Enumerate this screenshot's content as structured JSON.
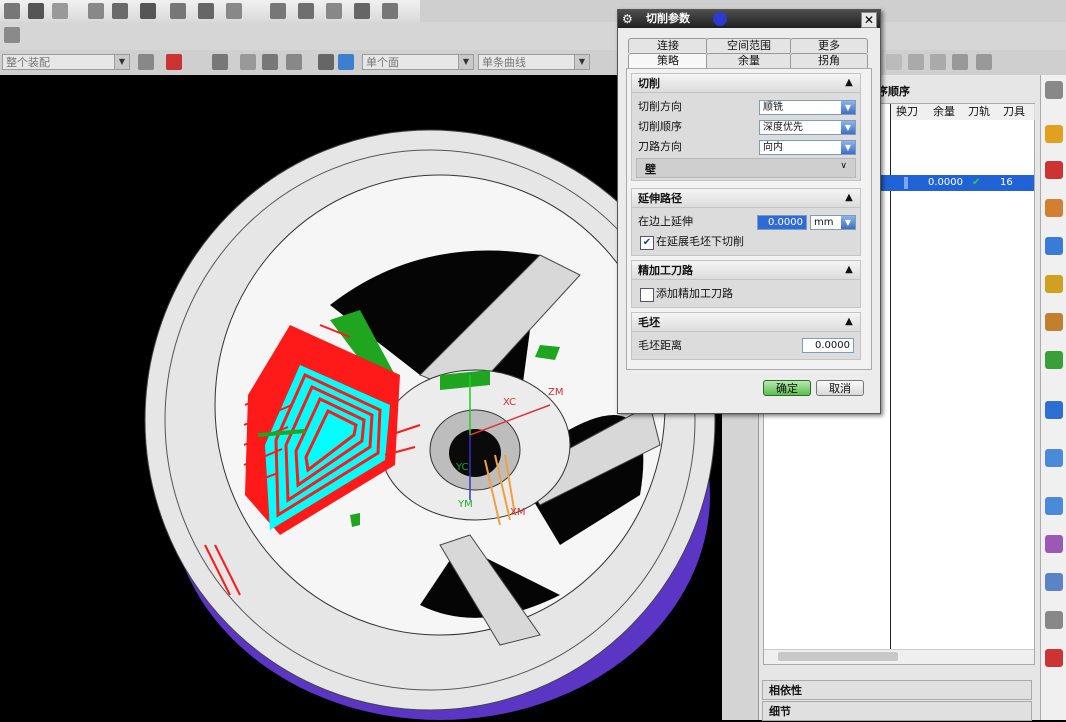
{
  "toolbar": {
    "combo_filter": "整个装配",
    "combo_single_face": "单个面",
    "combo_single_curve": "单条曲线"
  },
  "navigator": {
    "header": "序顺序",
    "columns": [
      "换刀",
      "余量",
      "刀轨",
      "刀具"
    ],
    "selected_row": {
      "allowance": "0.0000",
      "path_check": "✔",
      "tool": "16"
    },
    "sections": [
      "相依性",
      "细节"
    ]
  },
  "dialog": {
    "title": "切削参数",
    "tabs_top": [
      "连接",
      "空间范围",
      "更多"
    ],
    "tabs_bottom": [
      "策略",
      "余量",
      "拐角"
    ],
    "cutting": {
      "header": "切削",
      "direction_label": "切削方向",
      "direction_value": "顺铣",
      "order_label": "切削顺序",
      "order_value": "深度优先",
      "path_dir_label": "刀路方向",
      "path_dir_value": "向内",
      "wall_label": "壁"
    },
    "extend": {
      "header": "延伸路径",
      "edge_extend_label": "在边上延伸",
      "edge_extend_value": "0.0000",
      "unit": "mm",
      "cut_below_label": "在延展毛坯下切削"
    },
    "finish": {
      "header": "精加工刀路",
      "add_label": "添加精加工刀路"
    },
    "blank": {
      "header": "毛坯",
      "distance_label": "毛坯距离",
      "distance_value": "0.0000"
    },
    "ok": "确定",
    "cancel": "取消"
  },
  "viewport": {
    "axis_labels": [
      "XC",
      "YC",
      "ZM",
      "YM",
      "XM"
    ]
  },
  "colors": {
    "toolpath_red": "#ff1a1a",
    "stock_cyan": "#00ffff",
    "wall_green": "#22aa22",
    "fixture_purple": "#6a3fd6",
    "selection_blue": "#1f63d6"
  }
}
